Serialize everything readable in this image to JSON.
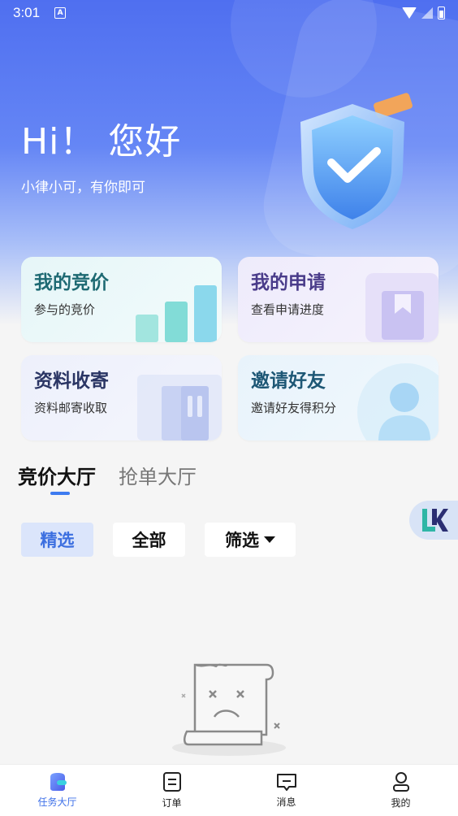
{
  "status_bar": {
    "time": "3:01",
    "notification_icon": "A"
  },
  "hero": {
    "title": "Hi！ 您好",
    "subtitle": "小律小可，有你即可"
  },
  "quick_cards": [
    {
      "title": "我的竞价",
      "subtitle": "参与的竞价",
      "icon": "bar-chart-icon"
    },
    {
      "title": "我的申请",
      "subtitle": "查看申请进度",
      "icon": "bookmark-book-icon"
    },
    {
      "title": "资料收寄",
      "subtitle": "资料邮寄收取",
      "icon": "folder-icon"
    },
    {
      "title": "邀请好友",
      "subtitle": "邀请好友得积分",
      "icon": "person-icon"
    }
  ],
  "hall_tabs": [
    {
      "label": "竞价大厅",
      "active": true
    },
    {
      "label": "抢单大厅",
      "active": false
    }
  ],
  "filters": [
    {
      "label": "精选",
      "selected": true
    },
    {
      "label": "全部",
      "selected": false
    },
    {
      "label": "筛选",
      "selected": false,
      "dropdown": true
    }
  ],
  "bottom_nav": [
    {
      "label": "任务大厅",
      "icon": "task-hall-icon",
      "active": true
    },
    {
      "label": "订单",
      "icon": "order-icon",
      "active": false
    },
    {
      "label": "消息",
      "icon": "message-icon",
      "active": false
    },
    {
      "label": "我的",
      "icon": "profile-icon",
      "active": false
    }
  ],
  "colors": {
    "accent": "#3d7bf0",
    "hero_top": "#4f6ff0",
    "chip_selected_bg": "#dbe5fb",
    "chip_selected_text": "#3c6fe0"
  }
}
